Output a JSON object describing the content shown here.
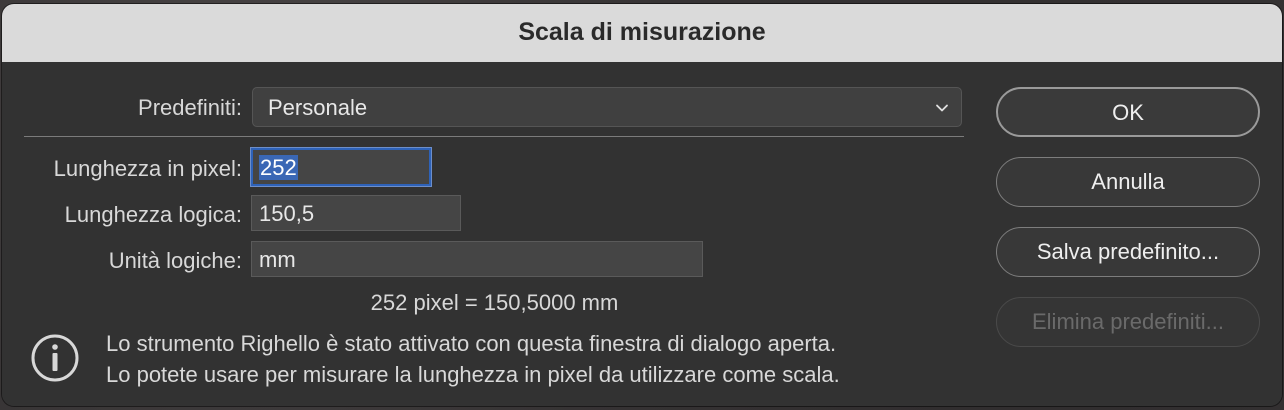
{
  "dialog": {
    "title": "Scala di misurazione"
  },
  "presets": {
    "label": "Predefiniti:",
    "value": "Personale"
  },
  "fields": {
    "pixel_length": {
      "label": "Lunghezza in pixel:",
      "value": "252"
    },
    "logical_length": {
      "label": "Lunghezza logica:",
      "value": "150,5"
    },
    "logical_units": {
      "label": "Unità logiche:",
      "value": "mm"
    }
  },
  "equation": "252 pixel = 150,5000 mm",
  "info": {
    "icon": "info-circle-icon",
    "line1": "Lo strumento Righello è stato attivato con questa finestra di dialogo aperta.",
    "line2": "Lo potete usare per misurare la lunghezza in pixel da utilizzare come scala."
  },
  "buttons": {
    "ok": "OK",
    "cancel": "Annulla",
    "save_preset": "Salva predefinito...",
    "delete_presets": "Elimina predefiniti..."
  },
  "colors": {
    "focus_ring": "#2e62b8",
    "selection": "#3a67b5",
    "dialog_bg": "#323232",
    "titlebar_bg": "#dadada"
  }
}
